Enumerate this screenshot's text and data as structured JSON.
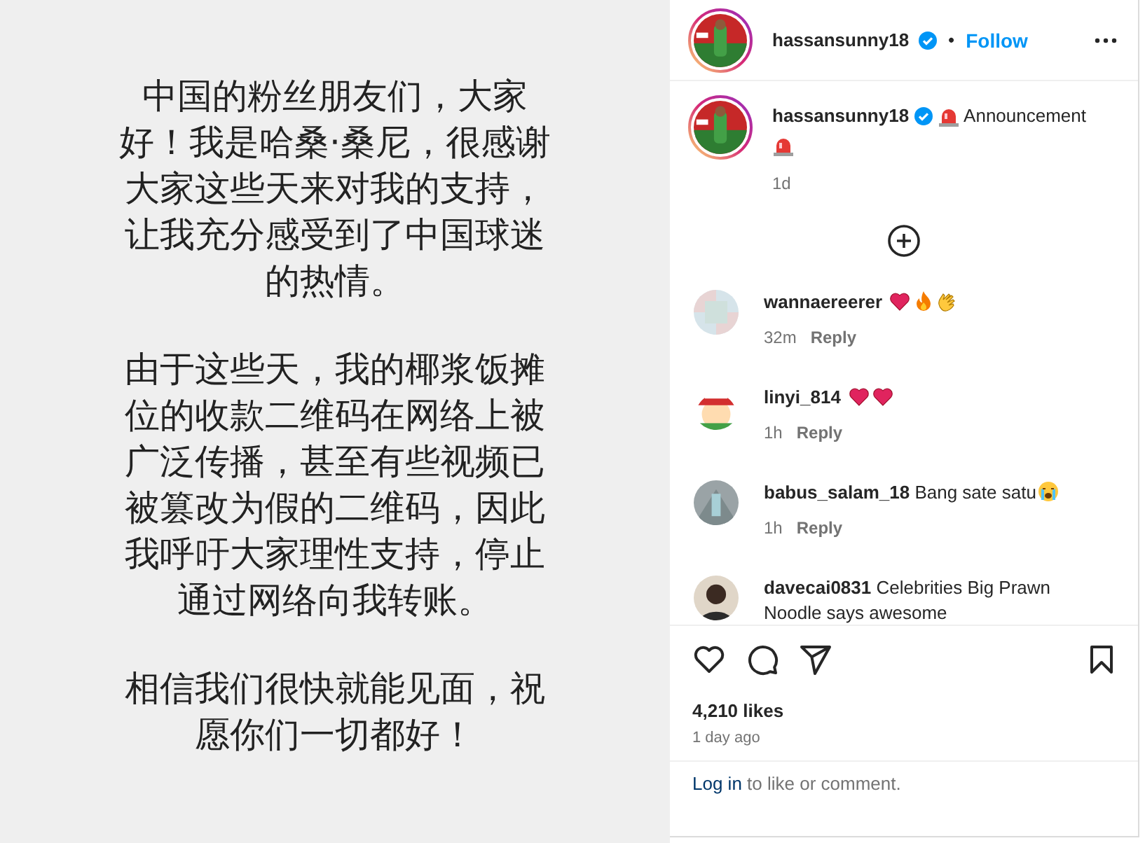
{
  "post_image": {
    "paragraphs": [
      "中国的粉丝朋友们，大家好！我是哈桑·桑尼，很感谢大家这些天来对我的支持，让我充分感受到了中国球迷的热情。",
      "由于这些天，我的椰浆饭摊位的收款二维码在网络上被广泛传播，甚至有些视频已被篡改为假的二维码，因此我呼吁大家理性支持，停止通过网络向我转账。",
      "相信我们很快就能见面，祝愿你们一切都好！"
    ]
  },
  "header": {
    "username": "hassansunny18",
    "verified": true,
    "separator": "•",
    "follow": "Follow"
  },
  "caption": {
    "username": "hassansunny18",
    "verified": true,
    "text": "Announcement",
    "time": "1d"
  },
  "comments": [
    {
      "username": "wannaereerer",
      "reactions": [
        {
          "kind": "heart"
        },
        {
          "kind": "fire"
        },
        {
          "kind": "clap"
        }
      ],
      "time": "32m",
      "reply": "Reply"
    },
    {
      "username": "linyi_814",
      "reactions": [
        {
          "kind": "heart"
        },
        {
          "kind": "heart"
        }
      ],
      "time": "1h",
      "reply": "Reply"
    },
    {
      "username": "babus_salam_18",
      "text": "Bang sate satu",
      "reactions": [
        {
          "kind": "crying"
        }
      ],
      "time": "1h",
      "reply": "Reply"
    },
    {
      "username": "davecai0831",
      "text": "Celebrities Big Prawn Noodle says awesome"
    }
  ],
  "likes": "4,210 likes",
  "date": "1 day ago",
  "login": {
    "link": "Log in",
    "text": "to like or comment."
  }
}
